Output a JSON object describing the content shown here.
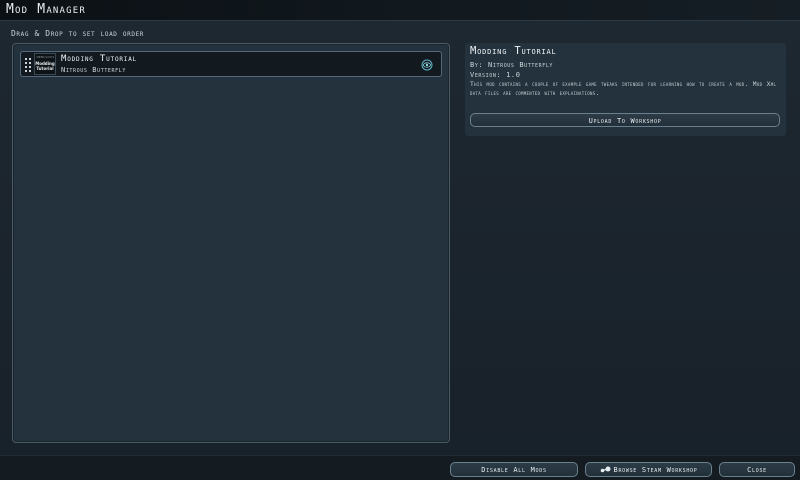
{
  "window": {
    "title": "Mod Manager"
  },
  "instructions": "Drag & Drop to set load order",
  "mod_list": [
    {
      "name": "Modding Tutorial",
      "author": "Nitrous Butterfly",
      "thumbnail_top": "NEBULOUS",
      "thumbnail_caption": "Modding Tutorial",
      "enabled_icon": "eye-icon",
      "handle_icon": "drag-handle-icon"
    }
  ],
  "details": {
    "title": "Modding Tutorial",
    "author_line": "By: Nitrous Butterfly",
    "version_line": "Version: 1.0",
    "description": "This mod contains a couple of example game tweaks intended for learning how to create a mod. Mod Xml data files are commented with explainations.",
    "upload_label": "Upload To Workshop"
  },
  "footer": {
    "disable_label": "Disable All Mods",
    "browse_label": "Browse Steam Workshop",
    "browse_icon": "steam-icon",
    "close_label": "Close"
  },
  "colors": {
    "background": "#1b242b",
    "panel": "#24323d",
    "border": "#4a5b66",
    "text": "#e6ecef",
    "accent_eye": "#5fb3c9"
  }
}
